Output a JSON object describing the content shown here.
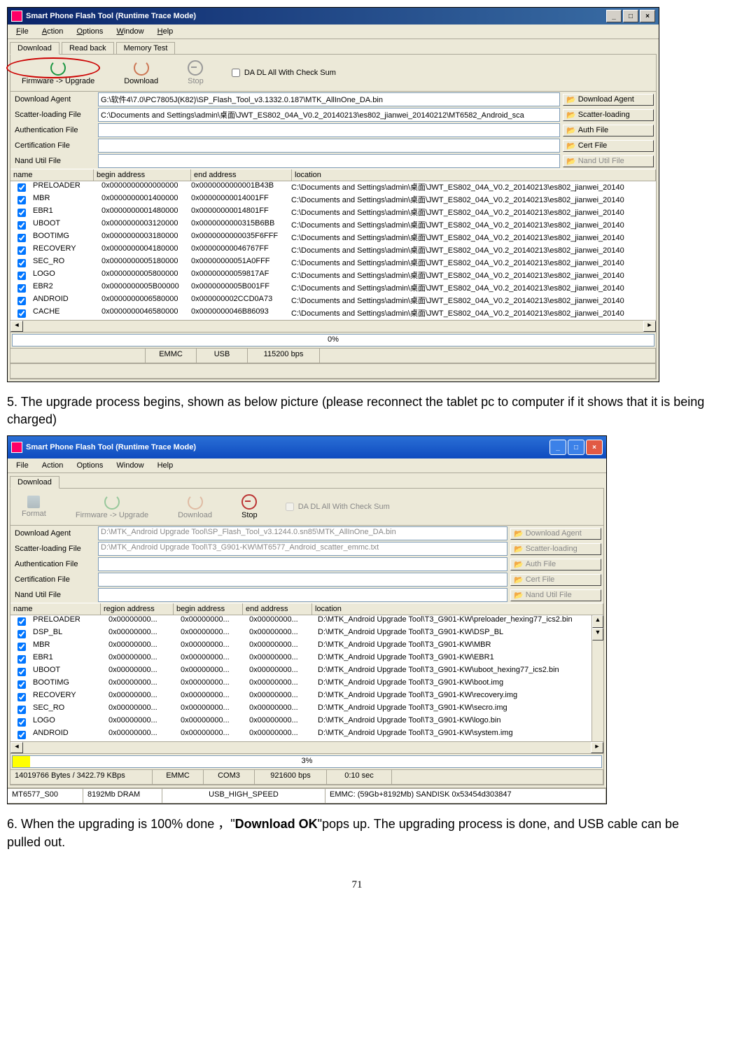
{
  "win1": {
    "title": "Smart Phone Flash Tool (Runtime Trace Mode)",
    "menu": [
      "File",
      "Action",
      "Options",
      "Window",
      "Help"
    ],
    "tabs": [
      "Download",
      "Read back",
      "Memory Test"
    ],
    "toolbar": {
      "upgrade": "Firmware -> Upgrade",
      "download": "Download",
      "stop": "Stop",
      "chk": "DA DL All With Check Sum"
    },
    "files": {
      "da_lab": "Download Agent",
      "da_val": "G:\\软件4\\7.0\\PC7805J(K82)\\SP_Flash_Tool_v3.1332.0.187\\MTK_AllInOne_DA.bin",
      "da_btn": "Download Agent",
      "sc_lab": "Scatter-loading File",
      "sc_val": "C:\\Documents and Settings\\admin\\桌面\\JWT_ES802_04A_V0.2_20140213\\es802_jianwei_20140212\\MT6582_Android_sca",
      "sc_btn": "Scatter-loading",
      "au_lab": "Authentication File",
      "au_btn": "Auth File",
      "ce_lab": "Certification File",
      "ce_btn": "Cert File",
      "na_lab": "Nand Util File",
      "na_btn": "Nand Util File"
    },
    "cols": {
      "name": "name",
      "begin": "begin address",
      "end": "end address",
      "loc": "location"
    },
    "rows": [
      {
        "n": "PRELOADER",
        "b": "0x0000000000000000",
        "e": "0x0000000000001B43B",
        "l": "C:\\Documents and Settings\\admin\\桌面\\JWT_ES802_04A_V0.2_20140213\\es802_jianwei_20140"
      },
      {
        "n": "MBR",
        "b": "0x0000000001400000",
        "e": "0x00000000014001FF",
        "l": "C:\\Documents and Settings\\admin\\桌面\\JWT_ES802_04A_V0.2_20140213\\es802_jianwei_20140"
      },
      {
        "n": "EBR1",
        "b": "0x0000000001480000",
        "e": "0x00000000014801FF",
        "l": "C:\\Documents and Settings\\admin\\桌面\\JWT_ES802_04A_V0.2_20140213\\es802_jianwei_20140"
      },
      {
        "n": "UBOOT",
        "b": "0x0000000003120000",
        "e": "0x0000000000315B6BB",
        "l": "C:\\Documents and Settings\\admin\\桌面\\JWT_ES802_04A_V0.2_20140213\\es802_jianwei_20140"
      },
      {
        "n": "BOOTIMG",
        "b": "0x0000000003180000",
        "e": "0x0000000000035F6FFF",
        "l": "C:\\Documents and Settings\\admin\\桌面\\JWT_ES802_04A_V0.2_20140213\\es802_jianwei_20140"
      },
      {
        "n": "RECOVERY",
        "b": "0x0000000004180000",
        "e": "0x00000000046767FF",
        "l": "C:\\Documents and Settings\\admin\\桌面\\JWT_ES802_04A_V0.2_20140213\\es802_jianwei_20140"
      },
      {
        "n": "SEC_RO",
        "b": "0x0000000005180000",
        "e": "0x00000000051A0FFF",
        "l": "C:\\Documents and Settings\\admin\\桌面\\JWT_ES802_04A_V0.2_20140213\\es802_jianwei_20140"
      },
      {
        "n": "LOGO",
        "b": "0x0000000005800000",
        "e": "0x00000000059817AF",
        "l": "C:\\Documents and Settings\\admin\\桌面\\JWT_ES802_04A_V0.2_20140213\\es802_jianwei_20140"
      },
      {
        "n": "EBR2",
        "b": "0x0000000005B00000",
        "e": "0x0000000005B001FF",
        "l": "C:\\Documents and Settings\\admin\\桌面\\JWT_ES802_04A_V0.2_20140213\\es802_jianwei_20140"
      },
      {
        "n": "ANDROID",
        "b": "0x0000000006580000",
        "e": "0x000000002CCD0A73",
        "l": "C:\\Documents and Settings\\admin\\桌面\\JWT_ES802_04A_V0.2_20140213\\es802_jianwei_20140"
      },
      {
        "n": "CACHE",
        "b": "0x0000000046580000",
        "e": "0x0000000046B86093",
        "l": "C:\\Documents and Settings\\admin\\桌面\\JWT_ES802_04A_V0.2_20140213\\es802_jianwei_20140"
      }
    ],
    "progress": "0%",
    "status": {
      "s1": "",
      "s2": "EMMC",
      "s3": "USB",
      "s4": "115200 bps"
    }
  },
  "text5": "5. The upgrade process begins, shown as below picture (please reconnect the tablet pc to computer if it shows that it is being charged)",
  "win2": {
    "title": "Smart Phone Flash Tool (Runtime Trace Mode)",
    "menu": [
      "File",
      "Action",
      "Options",
      "Window",
      "Help"
    ],
    "tabs": [
      "Download"
    ],
    "toolbar": {
      "format": "Format",
      "upgrade": "Firmware -> Upgrade",
      "download": "Download",
      "stop": "Stop",
      "chk": "DA DL All With Check Sum"
    },
    "files": {
      "da_lab": "Download Agent",
      "da_val": "D:\\MTK_Android Upgrade Tool\\SP_Flash_Tool_v3.1244.0.sn85\\MTK_AllInOne_DA.bin",
      "da_btn": "Download Agent",
      "sc_lab": "Scatter-loading File",
      "sc_val": "D:\\MTK_Android Upgrade Tool\\T3_G901-KW\\MT6577_Android_scatter_emmc.txt",
      "sc_btn": "Scatter-loading",
      "au_lab": "Authentication File",
      "au_btn": "Auth File",
      "ce_lab": "Certification File",
      "ce_btn": "Cert File",
      "na_lab": "Nand Util File",
      "na_btn": "Nand Util File"
    },
    "cols": {
      "name": "name",
      "region": "region address",
      "begin": "begin address",
      "end": "end address",
      "loc": "location"
    },
    "rows": [
      {
        "n": "PRELOADER",
        "r": "0x00000000...",
        "b": "0x00000000...",
        "e": "0x00000000...",
        "l": "D:\\MTK_Android Upgrade Tool\\T3_G901-KW\\preloader_hexing77_ics2.bin"
      },
      {
        "n": "DSP_BL",
        "r": "0x00000000...",
        "b": "0x00000000...",
        "e": "0x00000000...",
        "l": "D:\\MTK_Android Upgrade Tool\\T3_G901-KW\\DSP_BL"
      },
      {
        "n": "MBR",
        "r": "0x00000000...",
        "b": "0x00000000...",
        "e": "0x00000000...",
        "l": "D:\\MTK_Android Upgrade Tool\\T3_G901-KW\\MBR"
      },
      {
        "n": "EBR1",
        "r": "0x00000000...",
        "b": "0x00000000...",
        "e": "0x00000000...",
        "l": "D:\\MTK_Android Upgrade Tool\\T3_G901-KW\\EBR1"
      },
      {
        "n": "UBOOT",
        "r": "0x00000000...",
        "b": "0x00000000...",
        "e": "0x00000000...",
        "l": "D:\\MTK_Android Upgrade Tool\\T3_G901-KW\\uboot_hexing77_ics2.bin"
      },
      {
        "n": "BOOTIMG",
        "r": "0x00000000...",
        "b": "0x00000000...",
        "e": "0x00000000...",
        "l": "D:\\MTK_Android Upgrade Tool\\T3_G901-KW\\boot.img"
      },
      {
        "n": "RECOVERY",
        "r": "0x00000000...",
        "b": "0x00000000...",
        "e": "0x00000000...",
        "l": "D:\\MTK_Android Upgrade Tool\\T3_G901-KW\\recovery.img"
      },
      {
        "n": "SEC_RO",
        "r": "0x00000000...",
        "b": "0x00000000...",
        "e": "0x00000000...",
        "l": "D:\\MTK_Android Upgrade Tool\\T3_G901-KW\\secro.img"
      },
      {
        "n": "LOGO",
        "r": "0x00000000...",
        "b": "0x00000000...",
        "e": "0x00000000...",
        "l": "D:\\MTK_Android Upgrade Tool\\T3_G901-KW\\logo.bin"
      },
      {
        "n": "ANDROID",
        "r": "0x00000000...",
        "b": "0x00000000...",
        "e": "0x00000000...",
        "l": "D:\\MTK_Android Upgrade Tool\\T3_G901-KW\\system.img"
      }
    ],
    "progress": "3%",
    "progress_pct": 3,
    "status": {
      "s1": "14019766 Bytes / 3422.79 KBps",
      "s2": "EMMC",
      "s3": "COM3",
      "s4": "921600 bps",
      "s5": "0:10 sec"
    },
    "status2": {
      "a": "MT6577_S00",
      "b": "8192Mb DRAM",
      "c": "USB_HIGH_SPEED",
      "d": "EMMC: (59Gb+8192Mb) SANDISK 0x53454d303847"
    }
  },
  "text6a": "6. When the upgrading is 100% done ，\"",
  "text6b": "Download OK",
  "text6c": "\"pops up. The upgrading process is done, and USB cable can be pulled out.",
  "pagenum": "71"
}
